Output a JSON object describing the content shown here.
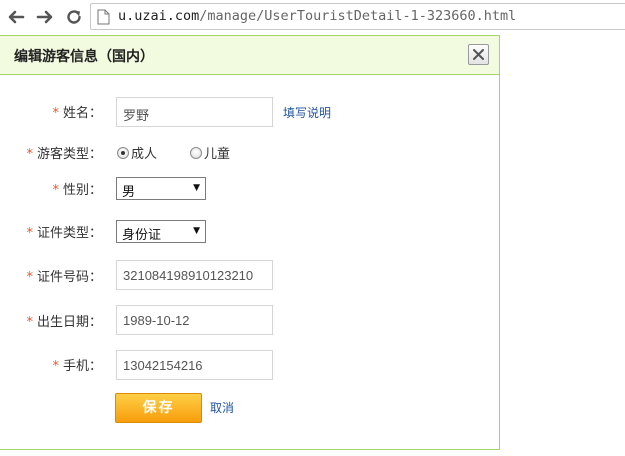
{
  "browser": {
    "url_host": "u.uzai.com",
    "url_path": "/manage/UserTouristDetail-1-323660.html"
  },
  "dialog": {
    "title": "编辑游客信息（国内）",
    "required_mark": "*",
    "name": {
      "label": "姓名：",
      "value": "罗野",
      "help_link": "填写说明"
    },
    "tourist_type": {
      "label": "游客类型：",
      "options": [
        "成人",
        "儿童"
      ],
      "selected": "成人"
    },
    "gender": {
      "label": "性别：",
      "value": "男"
    },
    "id_type": {
      "label": "证件类型：",
      "value": "身份证"
    },
    "id_number": {
      "label": "证件号码：",
      "value": "321084198910123210"
    },
    "birth_date": {
      "label": "出生日期：",
      "value": "1989-10-12"
    },
    "mobile": {
      "label": "手机：",
      "value": "13042154216"
    },
    "save_label": "保存",
    "cancel_label": "取消"
  },
  "colors": {
    "header_bg": "#f2fadf",
    "border": "#a7d36b",
    "required": "#e4572e",
    "link": "#2155a0",
    "save_button": "#f79d0c"
  }
}
